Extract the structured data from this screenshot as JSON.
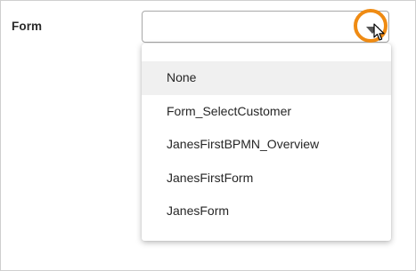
{
  "form_field": {
    "label": "Form",
    "selected_value": ""
  },
  "dropdown": {
    "options": [
      {
        "label": "None",
        "highlighted": true
      },
      {
        "label": "Form_SelectCustomer"
      },
      {
        "label": "JanesFirstBPMN_Overview"
      },
      {
        "label": "JanesFirstForm"
      },
      {
        "label": "JanesForm"
      }
    ]
  },
  "colors": {
    "highlight_ring": "#ef8b13",
    "selected_option_bg": "#f0f0f0"
  },
  "icons": {
    "dropdown_arrow": "caret-down-icon",
    "cursor": "mouse-pointer-icon"
  }
}
